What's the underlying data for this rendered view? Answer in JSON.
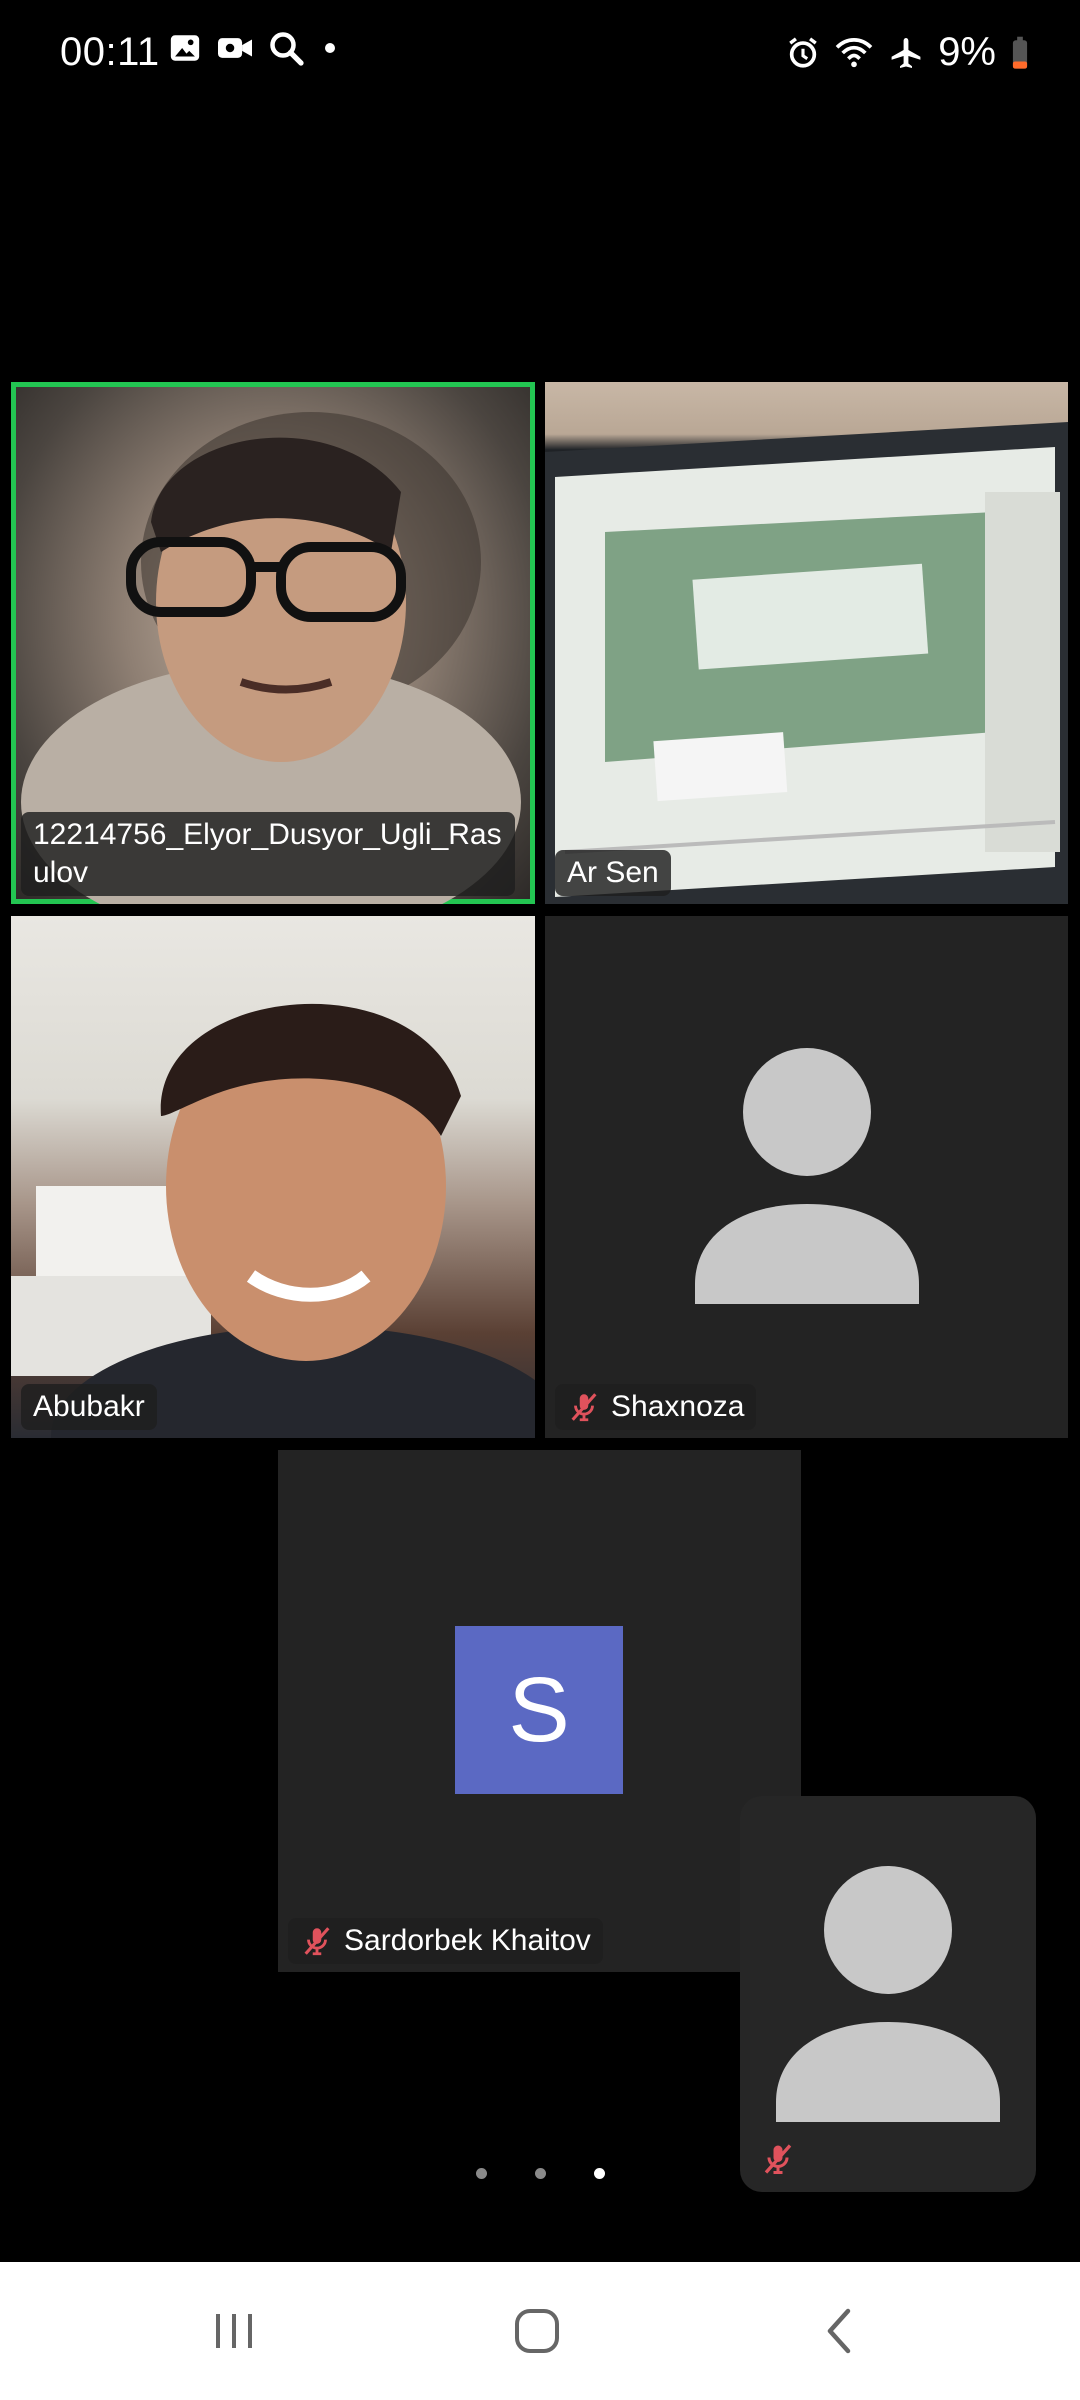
{
  "status_bar": {
    "time": "00:11",
    "battery_percent": "9%",
    "left_icons": [
      "gallery-icon",
      "video-record-icon",
      "search-icon",
      "dot-icon"
    ],
    "right_icons": [
      "alarm-icon",
      "wifi-icon",
      "airplane-icon",
      "battery-low-icon"
    ]
  },
  "participants": [
    {
      "name": "12214756_Elyor_Dusyor_Ugli_Rasulov",
      "display_lines": [
        "12214756_Elyor_Dusyor_Ugli_Ras",
        "ulov"
      ],
      "video": true,
      "active_speaker": true,
      "muted": false
    },
    {
      "name": "Ar Sen",
      "video": true,
      "muted": false
    },
    {
      "name": "Abubakr",
      "video": true,
      "muted": false
    },
    {
      "name": "Shaxnoza",
      "video": false,
      "muted": true
    },
    {
      "name": "Sardorbek Khaitov",
      "video": false,
      "muted": true,
      "avatar_letter": "S",
      "avatar_color": "#5b69c3"
    },
    {
      "name": "",
      "video": false,
      "muted": true,
      "self_view": true
    }
  ],
  "pager": {
    "pages": 3,
    "current": 3
  },
  "colors": {
    "active_speaker": "#23c552",
    "muted_mic": "#e0525c",
    "tile_bg": "#232323"
  },
  "nav_bar": [
    "recent-apps-icon",
    "home-icon",
    "back-icon"
  ]
}
